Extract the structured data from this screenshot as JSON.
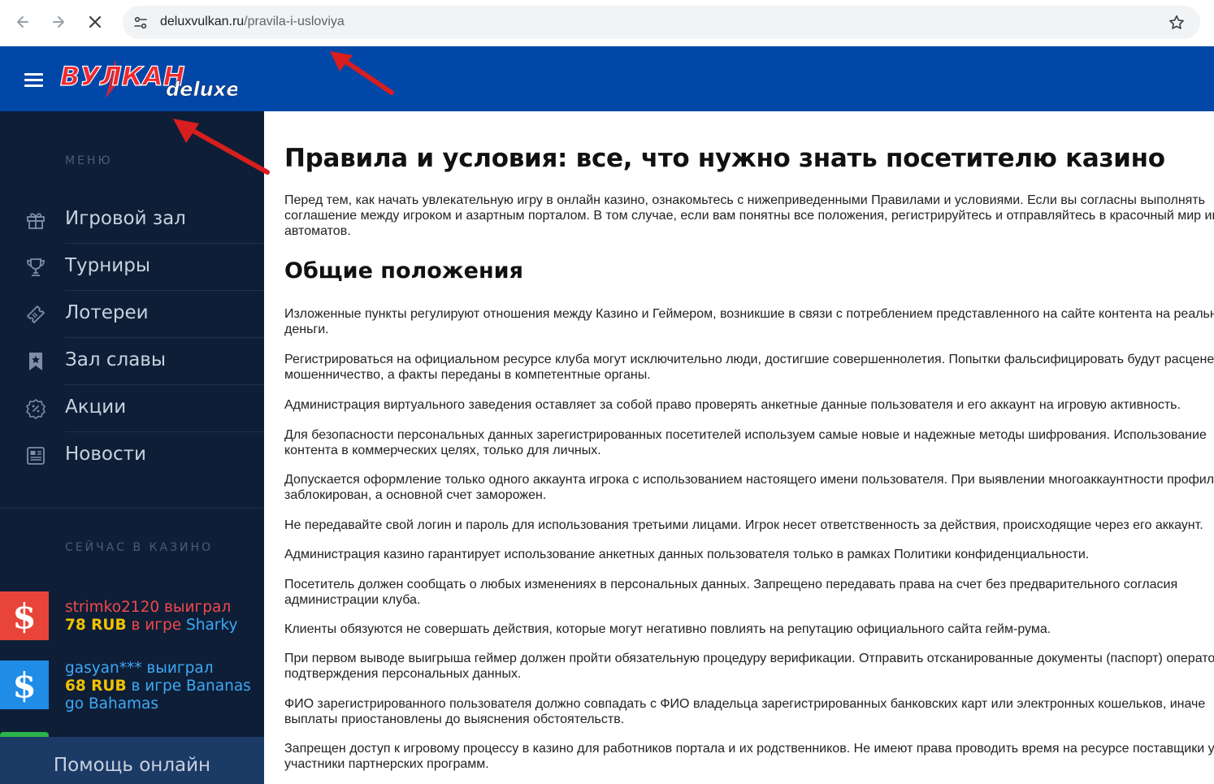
{
  "browser": {
    "url_host": "deluxvulkan.ru",
    "url_path": "/pravila-i-usloviya",
    "back_icon": "arrow-left-icon",
    "forward_icon": "arrow-right-icon",
    "stop_icon": "close-icon",
    "bookmark_icon": "star-icon"
  },
  "header": {
    "logo_text": "ВУЛКАН",
    "logo_sub": "deluxe",
    "brand_color": "#0047a8"
  },
  "sidebar": {
    "menu_label": "МЕНЮ",
    "items": [
      {
        "label": "Игровой зал",
        "icon": "gift-icon"
      },
      {
        "label": "Турниры",
        "icon": "trophy-icon"
      },
      {
        "label": "Лотереи",
        "icon": "ticket-icon"
      },
      {
        "label": "Зал славы",
        "icon": "bookmark-star-icon"
      },
      {
        "label": "Акции",
        "icon": "percent-badge-icon"
      },
      {
        "label": "Новости",
        "icon": "newspaper-icon"
      }
    ],
    "now_label": "СЕЙЧАС В КАЗИНО",
    "wins": [
      {
        "user": "strimko2120 выиграл",
        "amount": "78 RUB",
        "in_game": "в игре",
        "game": "Sharky",
        "badge_color": "#e8443a",
        "user_color": "#f2484a"
      },
      {
        "user": "gasyan*** выиграл",
        "amount": "68 RUB",
        "in_game": "в игре",
        "game": "Bananas",
        "game_line2": "go Bahamas",
        "badge_color": "#1f8ce6",
        "user_color": "#3da9f5"
      }
    ],
    "badge_symbol": "$",
    "help_label": "Помощь онлайн"
  },
  "main": {
    "title": "Правила и условия: все, что нужно знать посетителю казино",
    "intro": "Перед тем, как начать увлекательную игру в онлайн казино, ознакомьтесь с нижеприведенными Правилами и условиями. Если вы согласны выполнять соглашение между игроком и азартным порталом. В том случае, если вам понятны все положения, регистрируйтесь и отправляйтесь в красочный мир игровых автоматов.",
    "section_title": "Общие положения",
    "paragraphs": [
      "Изложенные пункты регулируют отношения между Казино и Геймером, возникшие в связи с потреблением представленного на сайте контента на реальные деньги.",
      "Регистрироваться на официальном ресурсе клуба могут исключительно люди, достигшие совершеннолетия. Попытки фальсифицировать будут расценены как мошенничество, а факты переданы в компетентные органы.",
      "Администрация виртуального заведения оставляет за собой право проверять анкетные данные пользователя и его аккаунт на игровую активность.",
      "Для безопасности персональных данных зарегистрированных посетителей используем самые новые и надежные методы шифрования. Использование контента в коммерческих целях, только для личных.",
      "Допускается оформление только одного аккаунта игрока с использованием настоящего имени пользователя. При выявлении многоаккаунтности профиль будет заблокирован, а основной счет заморожен.",
      "Не передавайте свой логин и пароль для использования третьими лицами. Игрок несет ответственность за действия, происходящие через его аккаунт.",
      "Администрация казино гарантирует использование анкетных данных пользователя только в рамках Политики конфиденциальности.",
      "Посетитель должен сообщать о любых изменениях в персональных данных. Запрещено передавать права на счет без предварительного согласия администрации клуба.",
      "Клиенты обязуются не совершать действия, которые могут негативно повлиять на репутацию официального сайта гейм-рума.",
      "При первом выводе выигрыша геймер должен пройти обязательную процедуру верификации. Отправить отсканированные документы (паспорт) оператору для подтверждения персональных данных.",
      "ФИО зарегистрированного пользователя должно совпадать с ФИО владельца зарегистрированных банковских карт или электронных кошельков, иначе выплаты приостановлены до выяснения обстоятельств.",
      "Запрещен доступ к игровому процессу в казино для работников портала и их родственников. Не имеют права проводить время на ресурсе поставщики услуг и участники партнерских программ."
    ]
  },
  "annotations": {
    "arrow_color": "#d81e1e"
  }
}
